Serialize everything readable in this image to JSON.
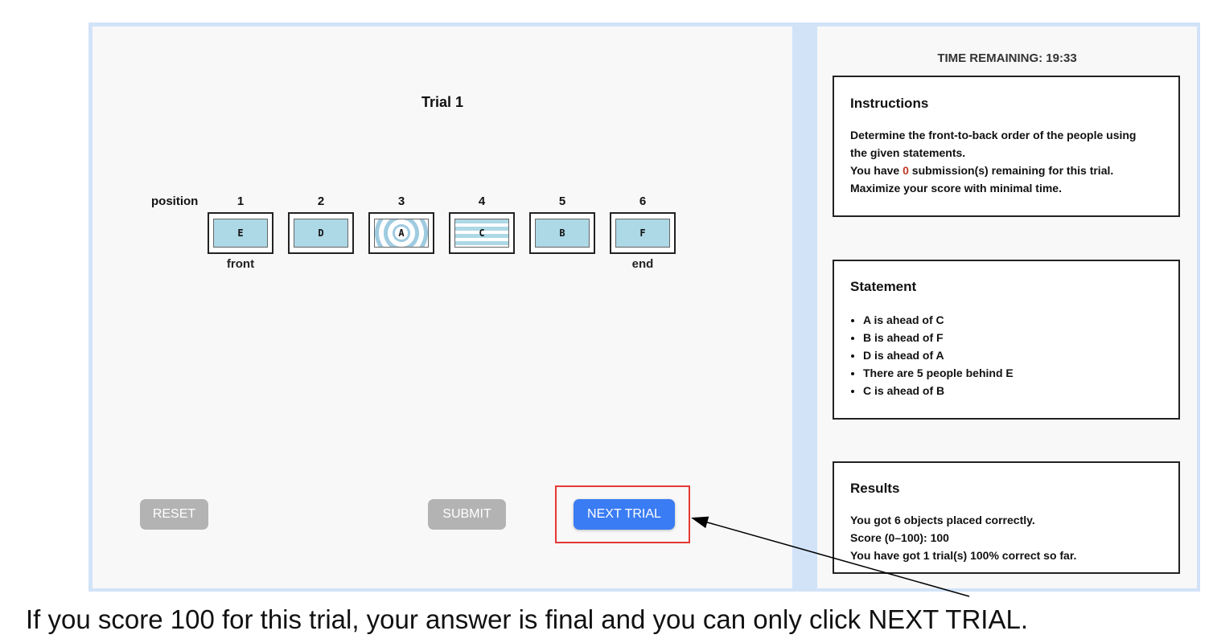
{
  "trial": {
    "title": "Trial 1"
  },
  "board": {
    "position_label": "position",
    "positions": [
      "1",
      "2",
      "3",
      "4",
      "5",
      "6"
    ],
    "tiles": [
      {
        "letter": "E",
        "pattern": "plain"
      },
      {
        "letter": "D",
        "pattern": "plain"
      },
      {
        "letter": "A",
        "pattern": "rings"
      },
      {
        "letter": "C",
        "pattern": "stripes"
      },
      {
        "letter": "B",
        "pattern": "plain"
      },
      {
        "letter": "F",
        "pattern": "plain"
      }
    ],
    "front_label": "front",
    "end_label": "end"
  },
  "buttons": {
    "reset": "RESET",
    "submit": "SUBMIT",
    "next_trial": "NEXT TRIAL"
  },
  "timer": {
    "text": "TIME REMAINING: 19:33"
  },
  "instructions": {
    "title": "Instructions",
    "line1": "Determine the front-to-back order of the people using",
    "line2": "the given statements.",
    "line3_prefix": "You have ",
    "line3_count": "0",
    "line3_suffix": " submission(s) remaining for this trial.",
    "line4": "Maximize your score with minimal time."
  },
  "statement": {
    "title": "Statement",
    "items": [
      "A is ahead of C",
      "B is ahead of F",
      "D is ahead of A",
      "There are 5 people behind E",
      "C is ahead of B"
    ]
  },
  "results": {
    "title": "Results",
    "line1": "You got 6 objects placed correctly.",
    "line2": "Score (0–100): 100",
    "line3": "You have got 1 trial(s) 100% correct so far."
  },
  "caption": "If you score 100 for this trial, your answer is final and you can only click NEXT TRIAL.",
  "colors": {
    "frame": "#d2e3f8",
    "panel": "#f8f8f8",
    "tile": "#add8e6",
    "primary_button": "#3a7cf3",
    "disabled_button": "#b3b3b3",
    "highlight": "#e53935",
    "remaining_count": "#c0392b"
  }
}
